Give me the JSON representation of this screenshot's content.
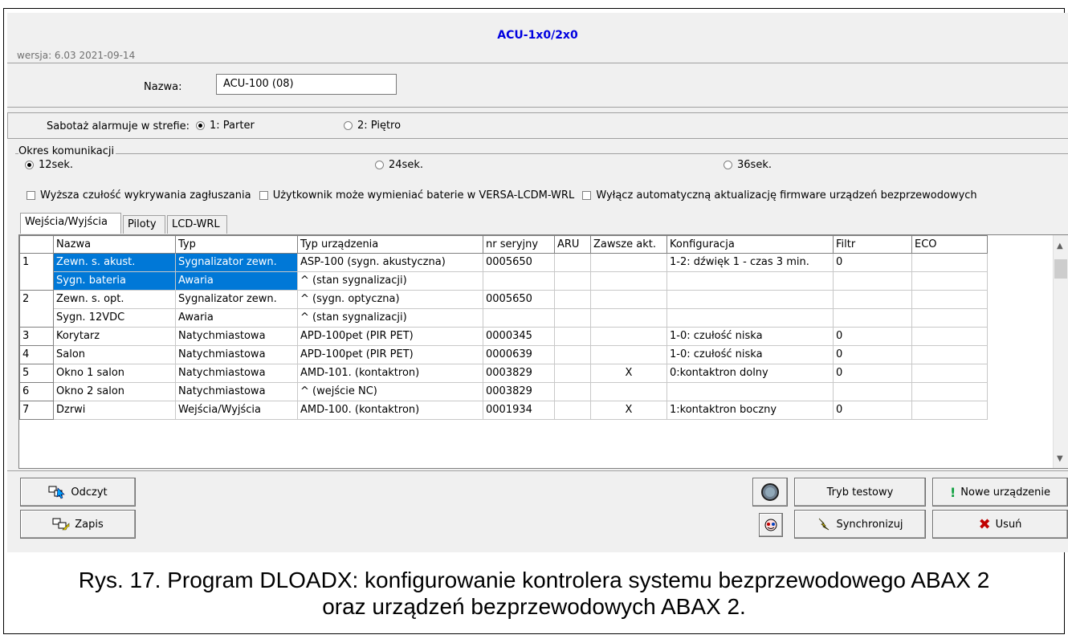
{
  "header": {
    "version": "wersja: 6.03 2021-09-14",
    "title": "ACU-1x0/2x0"
  },
  "name_field": {
    "label": "Nazwa:",
    "value": "ACU-100    (08)"
  },
  "sabotage": {
    "label": "Sabotaż alarmuje w strefie:",
    "options": [
      "1: Parter",
      "2: Piętro"
    ],
    "selected": "1: Parter"
  },
  "period": {
    "label": "Okres komunikacji",
    "options": [
      "12sek.",
      "24sek.",
      "36sek."
    ],
    "selected": "12sek."
  },
  "checkboxes": [
    {
      "label": "Wyższa czułość wykrywania zagłuszania",
      "checked": false
    },
    {
      "label": "Użytkownik może wymieniać baterie w VERSA-LCDM-WRL",
      "checked": false
    },
    {
      "label": "Wyłącz automatyczną aktualizację firmware urządzeń bezprzewodowych",
      "checked": false
    }
  ],
  "tabs": [
    "Wejścia/Wyjścia",
    "Piloty",
    "LCD-WRL"
  ],
  "table": {
    "columns": [
      "",
      "Nazwa",
      "Typ",
      "Typ urządzenia",
      "nr seryjny",
      "ARU",
      "Zawsze akt.",
      "Konfiguracja",
      "Filtr",
      "ECO"
    ],
    "rows": [
      {
        "num": "1",
        "lines": [
          [
            "Zewn. s. akust.",
            "Sygnalizator zewn.",
            "ASP-100 (sygn. akustyczna)",
            "0005650",
            "",
            "",
            "1-2: dźwięk 1 - czas 3 min.",
            "0",
            ""
          ],
          [
            "Sygn. bateria",
            "Awaria",
            "^            (stan sygnalizacji)",
            "",
            "",
            "",
            "",
            "",
            ""
          ]
        ]
      },
      {
        "num": "2",
        "lines": [
          [
            "Zewn. s. opt.",
            "Sygnalizator zewn.",
            "^            (sygn. optyczna)",
            "0005650",
            "",
            "",
            "",
            "",
            ""
          ],
          [
            "Sygn. 12VDC",
            "Awaria",
            "^            (stan sygnalizacji)",
            "",
            "",
            "",
            "",
            "",
            ""
          ]
        ]
      },
      {
        "num": "3",
        "lines": [
          [
            "Korytarz",
            "Natychmiastowa",
            "APD-100pet (PIR PET)",
            "0000345",
            "",
            "",
            "1-0: czułość niska",
            "0",
            ""
          ]
        ]
      },
      {
        "num": "4",
        "lines": [
          [
            "Salon",
            "Natychmiastowa",
            "APD-100pet (PIR PET)",
            "0000639",
            "",
            "",
            "1-0: czułość niska",
            "0",
            ""
          ]
        ]
      },
      {
        "num": "5",
        "lines": [
          [
            "Okno 1 salon",
            "Natychmiastowa",
            "AMD-101. (kontaktron)",
            "0003829",
            "",
            "X",
            "0:kontaktron dolny",
            "0",
            ""
          ]
        ]
      },
      {
        "num": "6",
        "lines": [
          [
            "Okno 2 salon",
            "Natychmiastowa",
            "^              (wejście NC)",
            "0003829",
            "",
            "",
            "",
            "",
            ""
          ]
        ]
      },
      {
        "num": "7",
        "lines": [
          [
            "Dzrwi",
            "Wejścia/Wyjścia",
            "AMD-100. (kontaktron)",
            "0001934",
            "",
            "X",
            "1:kontaktron boczny",
            "0",
            ""
          ]
        ]
      }
    ]
  },
  "buttons": {
    "read": "Odczyt",
    "write": "Zapis",
    "test_mode": "Tryb testowy",
    "new_device": "Nowe urządzenie",
    "sync": "Synchronizuj",
    "delete": "Usuń"
  },
  "caption": {
    "line1": "Rys. 17. Program DLOADX: konfigurowanie kontrolera systemu bezprzewodowego ABAX 2",
    "line2": "oraz urządzeń bezprzewodowych ABAX 2."
  }
}
